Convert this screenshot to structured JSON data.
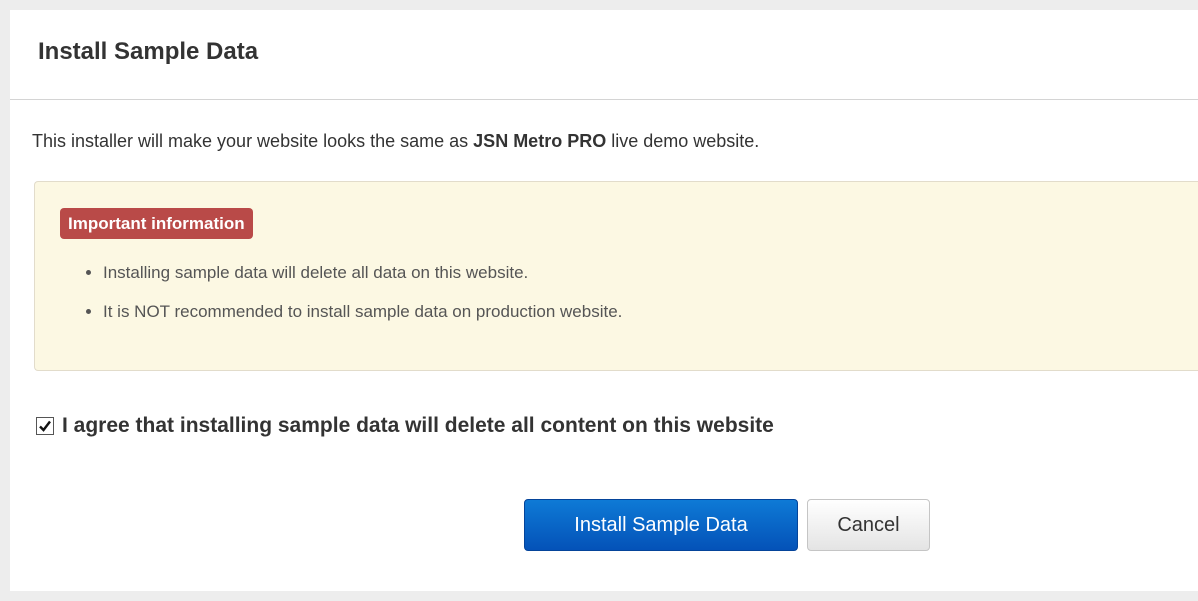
{
  "dialog": {
    "title": "Install Sample Data",
    "intro_before": "This installer will make your website looks the same as ",
    "intro_product": "JSN Metro PRO",
    "intro_after": " live demo website."
  },
  "alert": {
    "badge": "Important information",
    "items": [
      "Installing sample data will delete all data on this website.",
      "It is NOT recommended to install sample data on production website."
    ],
    "badge_color": "#b94a48",
    "background_color": "#fcf8e3"
  },
  "agreement": {
    "checked": true,
    "label": "I agree that installing sample data will delete all content on this website",
    "checkmark_icon": "check-icon"
  },
  "buttons": {
    "install_label": "Install Sample Data",
    "cancel_label": "Cancel",
    "primary_color": "#0a66c8"
  }
}
